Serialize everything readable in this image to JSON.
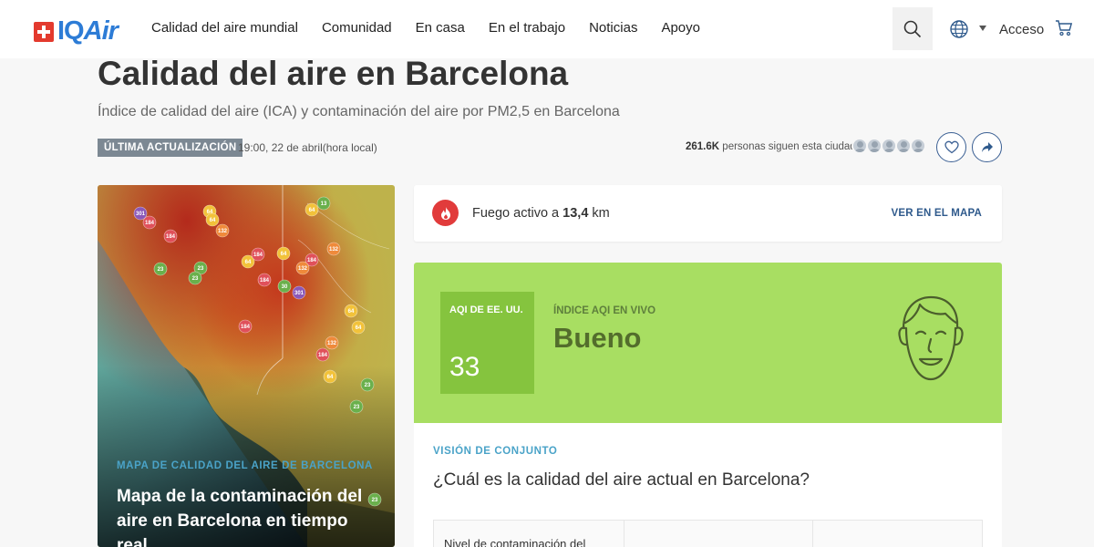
{
  "header": {
    "brand_prefix": "IQ",
    "brand_suffix": "Air",
    "nav": [
      "Calidad del aire mundial",
      "Comunidad",
      "En casa",
      "En el trabajo",
      "Noticias",
      "Apoyo"
    ],
    "login": "Acceso"
  },
  "page": {
    "title": "Calidad del aire en Barcelona",
    "subtitle": "Índice de calidad del aire (ICA) y contaminación del aire por PM2,5 en Barcelona",
    "badge": "ÚLTIMA ACTUALIZACIÓN",
    "updated": "19:00, 22 de abril(hora local)",
    "followers_count": "261.6K",
    "followers_text": "personas siguen esta ciudad"
  },
  "map": {
    "kicker": "MAPA DE CALIDAD DEL AIRE DE BARCELONA",
    "title": "Mapa de la contaminación del aire en Barcelona en tiempo real",
    "stations": [
      "301",
      "184",
      "64",
      "13",
      "64",
      "184",
      "23",
      "23",
      "23",
      "64",
      "132",
      "64",
      "184",
      "132",
      "184",
      "30",
      "184",
      "64",
      "132",
      "301",
      "184",
      "64",
      "64",
      "132",
      "184",
      "64",
      "23",
      "23",
      "23"
    ]
  },
  "fire": {
    "prefix": "Fuego activo a",
    "distance": "13,4",
    "unit": "km",
    "link": "VER EN EL MAPA"
  },
  "aqi": {
    "label": "AQI DE EE. UU.",
    "value": "33",
    "kicker": "ÍNDICE AQI EN VIVO",
    "level": "Bueno"
  },
  "overview": {
    "kicker": "VISIÓN DE CONJUNTO",
    "question": "¿Cuál es la calidad del aire actual en Barcelona?",
    "table_header": "Nivel de contaminación del"
  },
  "colors": {
    "aqi_good_bg": "#a8de62",
    "aqi_good_box": "#85c43e",
    "brand_blue": "#2d7cd6",
    "fire_red": "#e13b3b"
  }
}
